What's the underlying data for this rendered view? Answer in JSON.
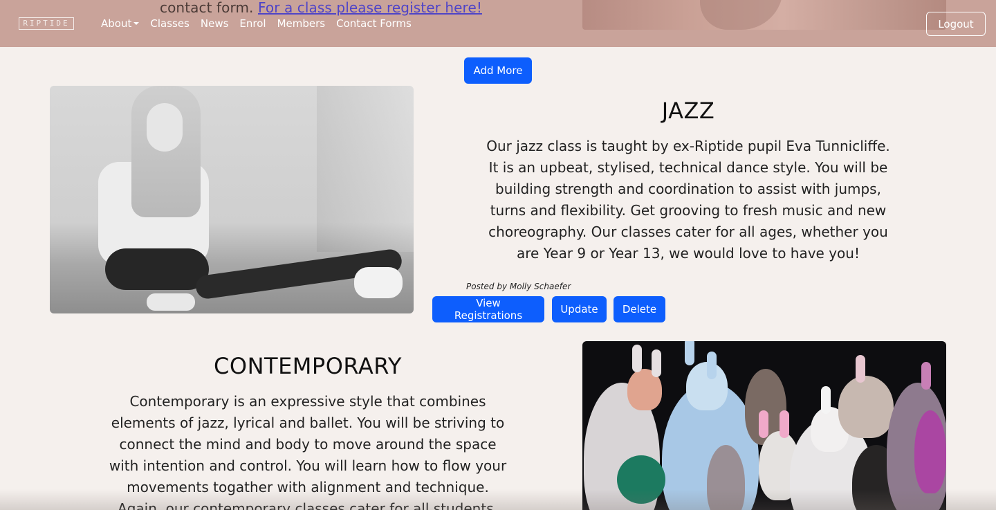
{
  "navbar": {
    "brand": "RIPTIDE",
    "behind_text_prefix": "contact form.",
    "behind_link": "For a class please register here!",
    "links": [
      {
        "label": "About",
        "has_caret": true
      },
      {
        "label": "Classes"
      },
      {
        "label": "News"
      },
      {
        "label": "Enrol"
      },
      {
        "label": "Members"
      },
      {
        "label": "Contact Forms"
      }
    ],
    "logout_label": "Logout"
  },
  "add_more_label": "Add More",
  "classes": [
    {
      "title": "JAZZ",
      "description": "Our jazz class is taught by ex-Riptide pupil Eva Tunnicliffe. It is an upbeat, stylised, technical dance style. You will be building strength and coordination to assist with jumps, turns and flexibility. Get grooving to fresh music and new choreography. Our classes cater for all ages, whether you are Year 9 or Year 13, we would love to have you!",
      "posted_by": "Posted by Molly Schaefer",
      "actions": {
        "view": "View Registrations",
        "update": "Update",
        "delete": "Delete"
      }
    },
    {
      "title": "CONTEMPORARY",
      "description": "Contemporary is an expressive style that combines elements of jazz, lyrical and ballet. You will be striving to connect the mind and body to move around the space with intention and control. You will learn how to flow your movements togather with alignment and technique. Again, our contemporary classes cater for all students."
    }
  ],
  "colors": {
    "navbar_bg": "#c9a39a",
    "page_bg": "#f5f0ed",
    "primary_button": "#0d5efd",
    "link": "#4f44c7"
  }
}
